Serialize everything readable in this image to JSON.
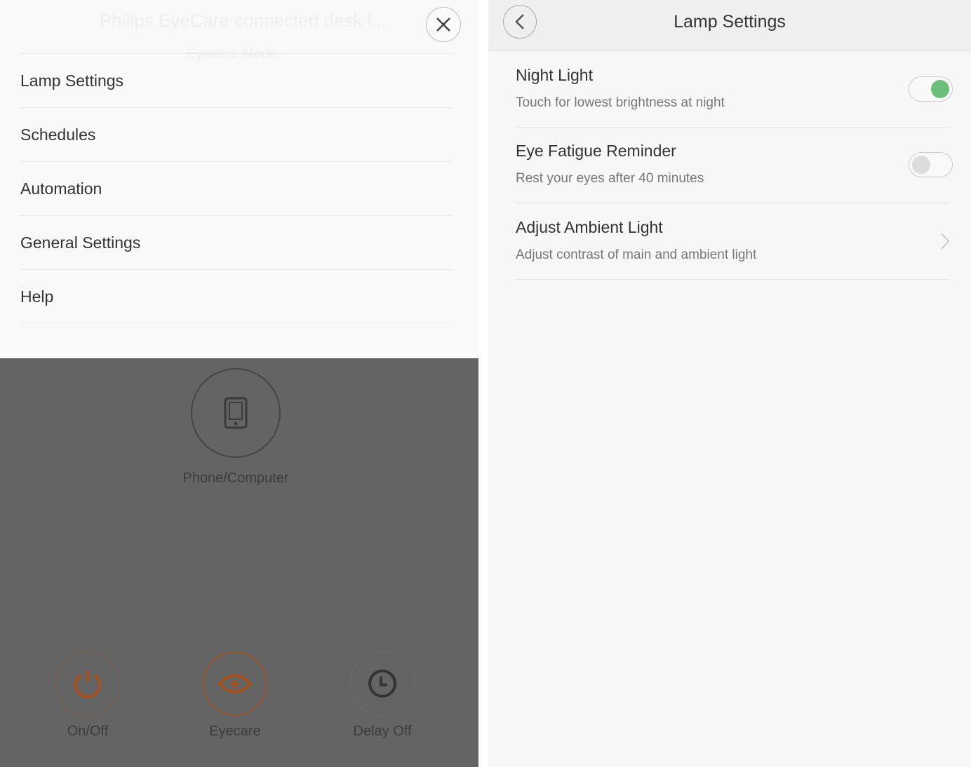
{
  "background_screen": {
    "title": "Philips EyeCare connected desk l...",
    "mode_label": "Eyecare Mode"
  },
  "menu": {
    "items": [
      {
        "label": "Lamp Settings"
      },
      {
        "label": "Schedules"
      },
      {
        "label": "Automation"
      },
      {
        "label": "General Settings"
      },
      {
        "label": "Help"
      }
    ]
  },
  "dimmed": {
    "source_label": "Phone/Computer",
    "controls": [
      {
        "label": "On/Off",
        "icon": "power-icon",
        "active": true
      },
      {
        "label": "Eyecare",
        "icon": "eye-plus-icon",
        "active": true
      },
      {
        "label": "Delay Off",
        "icon": "clock-icon",
        "active": false
      }
    ]
  },
  "lamp_settings": {
    "title": "Lamp Settings",
    "rows": [
      {
        "title": "Night Light",
        "subtitle": "Touch for lowest brightness at night",
        "control": "toggle",
        "on": true
      },
      {
        "title": "Eye Fatigue Reminder",
        "subtitle": "Rest your eyes after 40 minutes",
        "control": "toggle",
        "on": false
      },
      {
        "title": "Adjust Ambient Light",
        "subtitle": "Adjust contrast of main and ambient light",
        "control": "chevron"
      }
    ]
  },
  "colors": {
    "accent_orange": "#a8501e",
    "toggle_on": "#6cbf7a",
    "toggle_off": "#dcdcdc"
  }
}
